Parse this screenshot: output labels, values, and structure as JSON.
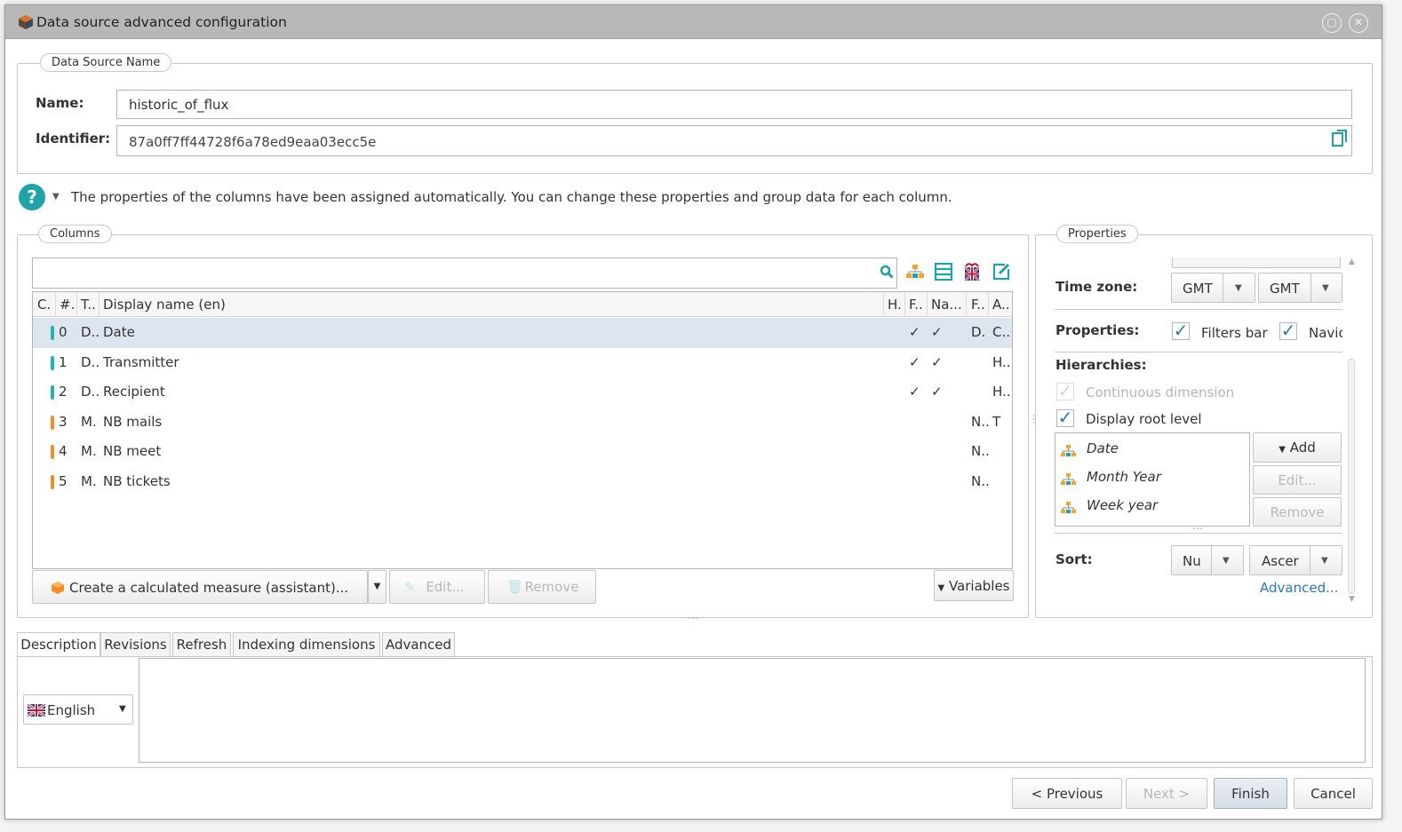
{
  "dialog": {
    "title": "Data source advanced configuration"
  },
  "datasource": {
    "legend": "Data Source Name",
    "name_label": "Name:",
    "name_value": "historic_of_flux",
    "id_label": "Identifier:",
    "id_value": "87a0ff7ff44728f6a78ed9eaa03ecc5e"
  },
  "info_text": "The properties of the columns have been assigned automatically. You can change these properties and group data for each column.",
  "columns": {
    "legend": "Columns",
    "headers": [
      "C.",
      "#.",
      "T..",
      "Display name (en)",
      "H.",
      "F..",
      "Na...",
      "F..",
      "A.."
    ],
    "rows": [
      {
        "index": "0",
        "type": "D..",
        "name": "Date",
        "f1": "✓",
        "na": "✓",
        "f2": "D.",
        "a": "C..",
        "color": "#1fb5b5"
      },
      {
        "index": "1",
        "type": "D..",
        "name": "Transmitter",
        "f1": "✓",
        "na": "✓",
        "f2": "",
        "a": "H..",
        "color": "#1fb5b5"
      },
      {
        "index": "2",
        "type": "D..",
        "name": "Recipient",
        "f1": "✓",
        "na": "✓",
        "f2": "",
        "a": "H..",
        "color": "#1fb5b5"
      },
      {
        "index": "3",
        "type": "M.",
        "name": "NB mails",
        "f1": "",
        "na": "",
        "f2": "N..",
        "a": "T",
        "color": "#f28c28"
      },
      {
        "index": "4",
        "type": "M.",
        "name": "NB meet",
        "f1": "",
        "na": "",
        "f2": "N..",
        "a": "",
        "color": "#f28c28"
      },
      {
        "index": "5",
        "type": "M.",
        "name": "NB tickets",
        "f1": "",
        "na": "",
        "f2": "N..",
        "a": "",
        "color": "#f28c28"
      }
    ],
    "create_label": "Create a calculated measure (assistant)...",
    "edit_label": "Edit...",
    "remove_label": "Remove",
    "variables_label": "Variables"
  },
  "properties": {
    "legend": "Properties",
    "timezone_label": "Time zone:",
    "tz1": "GMT",
    "tz2": "GMT",
    "properties_label": "Properties:",
    "filters_bar": "Filters bar",
    "navig": "Navic",
    "hierarchies_label": "Hierarchies:",
    "continuous": "Continuous dimension",
    "display_root": "Display root level",
    "hierarchies": [
      "Date",
      "Month Year",
      "Week year"
    ],
    "add_label": "Add",
    "edit_label": "Edit...",
    "remove_label": "Remove",
    "sort_label": "Sort:",
    "sort1": "Nu",
    "sort2": "Ascer",
    "advanced_link": "Advanced..."
  },
  "tabs": [
    "Description",
    "Revisions",
    "Refresh",
    "Indexing dimensions",
    "Advanced"
  ],
  "description": {
    "language": "English"
  },
  "footer": {
    "previous": "< Previous",
    "next": "Next >",
    "finish": "Finish",
    "cancel": "Cancel"
  },
  "colors": {
    "accent": "#1fa3a8",
    "link": "#2a7bb5",
    "dimension": "#1fb5b5",
    "measure": "#f28c28",
    "selected_row": "#dde6ef"
  }
}
